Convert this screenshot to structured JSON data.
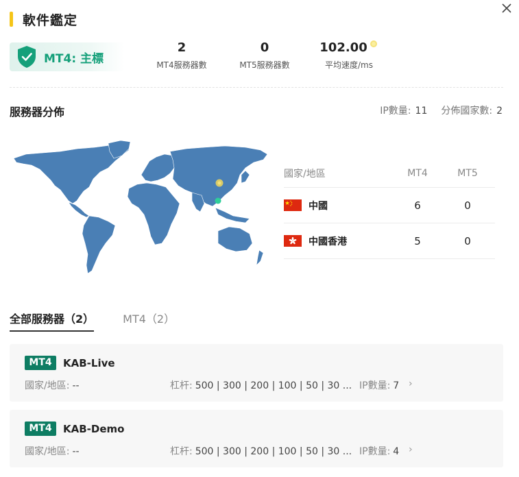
{
  "header": {
    "title": "軟件鑑定"
  },
  "badge": {
    "label": "MT4: 主標"
  },
  "stats": [
    {
      "value": "2",
      "label": "MT4服務器數"
    },
    {
      "value": "0",
      "label": "MT5服務器數"
    },
    {
      "value": "102.00",
      "label": "平均速度/ms"
    }
  ],
  "distribution": {
    "title": "服務器分佈",
    "ip_label": "IP數量:",
    "ip_count": "11",
    "countries_label": "分佈國家數:",
    "countries_count": "2"
  },
  "country_table": {
    "headers": [
      "國家/地區",
      "MT4",
      "MT5"
    ],
    "rows": [
      {
        "flag": "china-flag-icon",
        "name": "中國",
        "mt4": "6",
        "mt5": "0"
      },
      {
        "flag": "hong-kong-flag-icon",
        "name": "中國香港",
        "mt4": "5",
        "mt5": "0"
      }
    ]
  },
  "tabs": [
    {
      "label": "全部服務器（2）",
      "active": true
    },
    {
      "label": "MT4（2）",
      "active": false
    }
  ],
  "servers": [
    {
      "tag": "MT4",
      "name": "KAB-Live",
      "region_label": "國家/地區:",
      "region_value": "--",
      "leverage_label": "杠杆:",
      "leverage_value": "500 | 300 | 200 | 100 | 50 | 30 ...",
      "ip_label": "IP數量:",
      "ip_value": "7",
      "chevron": "›"
    },
    {
      "tag": "MT4",
      "name": "KAB-Demo",
      "region_label": "國家/地區:",
      "region_value": "--",
      "leverage_label": "杠杆:",
      "leverage_value": "500 | 300 | 200 | 100 | 50 | 30 ...",
      "ip_label": "IP數量:",
      "ip_value": "4",
      "chevron": "›"
    }
  ],
  "colors": {
    "accent_yellow": "#f5c518",
    "brand_green": "#15a07a",
    "tag_green": "#0e7d63",
    "map_blue": "#4a7fb5",
    "china_red": "#de2910",
    "hk_red": "#de2910"
  }
}
